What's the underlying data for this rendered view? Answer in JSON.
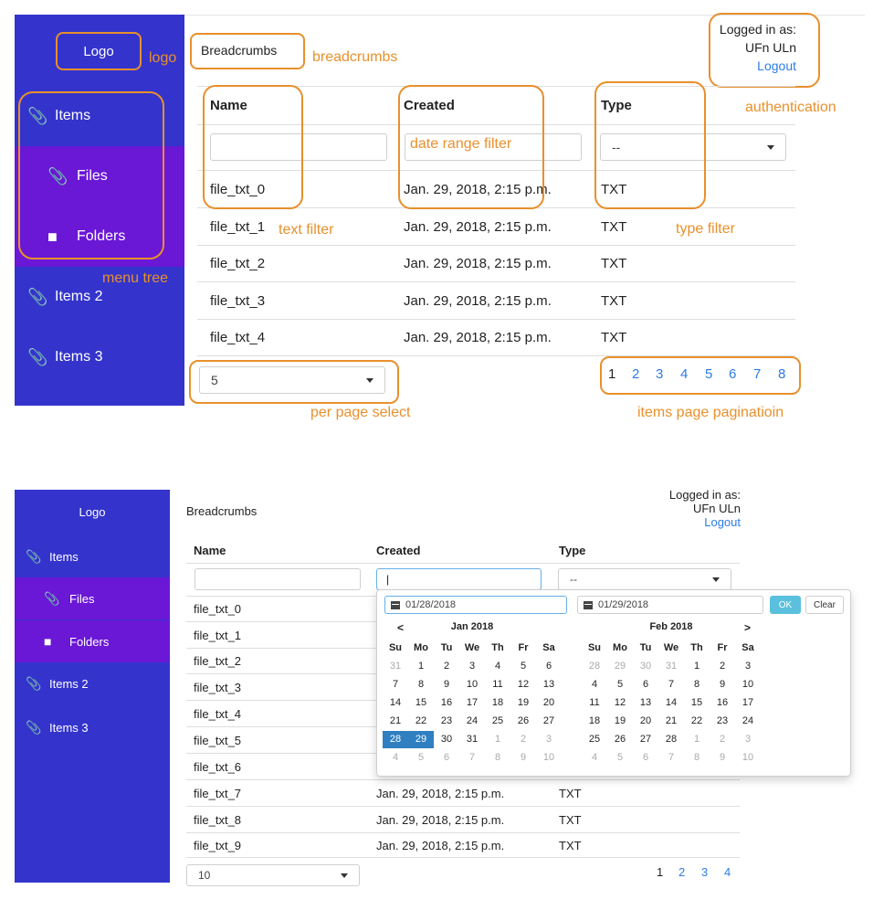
{
  "top": {
    "logo": "Logo",
    "breadcrumbs": "Breadcrumbs",
    "auth": {
      "logged_in_as": "Logged in as:",
      "user": "UFn ULn",
      "logout": "Logout"
    },
    "menu": [
      {
        "label": "Items",
        "icon": "paperclip-icon",
        "sub": false
      },
      {
        "label": "Files",
        "icon": "paperclip-icon",
        "sub": true
      },
      {
        "label": "Folders",
        "icon": "folder-icon",
        "sub": true
      },
      {
        "label": "Items 2",
        "icon": "paperclip-icon",
        "sub": false
      },
      {
        "label": "Items 3",
        "icon": "paperclip-icon",
        "sub": false
      }
    ],
    "columns": [
      "Name",
      "Created",
      "Type"
    ],
    "filters": {
      "type_select": "--"
    },
    "rows": [
      {
        "name": "file_txt_0",
        "created": "Jan. 29, 2018, 2:15 p.m.",
        "type": "TXT"
      },
      {
        "name": "file_txt_1",
        "created": "Jan. 29, 2018, 2:15 p.m.",
        "type": "TXT"
      },
      {
        "name": "file_txt_2",
        "created": "Jan. 29, 2018, 2:15 p.m.",
        "type": "TXT"
      },
      {
        "name": "file_txt_3",
        "created": "Jan. 29, 2018, 2:15 p.m.",
        "type": "TXT"
      },
      {
        "name": "file_txt_4",
        "created": "Jan. 29, 2018, 2:15 p.m.",
        "type": "TXT"
      }
    ],
    "per_page": "5",
    "pages": [
      "1",
      "2",
      "3",
      "4",
      "5",
      "6",
      "7",
      "8"
    ],
    "annotations": {
      "logo": "logo",
      "breadcrumbs": "breadcrumbs",
      "authentication": "authentication",
      "date_range_filter": "date range filter",
      "text_filter": "text filter",
      "type_filter": "type filter",
      "menu_tree": "menu tree",
      "per_page_select": "per page select",
      "pagination": "items page paginatioin"
    },
    "annotation_color": "#e8902c"
  },
  "bottom": {
    "logo": "Logo",
    "breadcrumbs": "Breadcrumbs",
    "auth": {
      "logged_in_as": "Logged in as:",
      "user": "UFn ULn",
      "logout": "Logout"
    },
    "menu": [
      {
        "label": "Items",
        "icon": "paperclip-icon",
        "sub": false
      },
      {
        "label": "Files",
        "icon": "paperclip-icon",
        "sub": true
      },
      {
        "label": "Folders",
        "icon": "folder-icon",
        "sub": true
      },
      {
        "label": "Items 2",
        "icon": "paperclip-icon",
        "sub": false
      },
      {
        "label": "Items 3",
        "icon": "paperclip-icon",
        "sub": false
      }
    ],
    "columns": [
      "Name",
      "Created",
      "Type"
    ],
    "filters": {
      "type_select": "--",
      "date_value": "|"
    },
    "rows": [
      {
        "name": "file_txt_0",
        "created": "",
        "type": ""
      },
      {
        "name": "file_txt_1",
        "created": "",
        "type": ""
      },
      {
        "name": "file_txt_2",
        "created": "",
        "type": ""
      },
      {
        "name": "file_txt_3",
        "created": "",
        "type": ""
      },
      {
        "name": "file_txt_4",
        "created": "",
        "type": ""
      },
      {
        "name": "file_txt_5",
        "created": "",
        "type": ""
      },
      {
        "name": "file_txt_6",
        "created": "",
        "type": ""
      },
      {
        "name": "file_txt_7",
        "created": "Jan. 29, 2018, 2:15 p.m.",
        "type": "TXT"
      },
      {
        "name": "file_txt_8",
        "created": "Jan. 29, 2018, 2:15 p.m.",
        "type": "TXT"
      },
      {
        "name": "file_txt_9",
        "created": "Jan. 29, 2018, 2:15 p.m.",
        "type": "TXT"
      }
    ],
    "per_page": "10",
    "pages": [
      "1",
      "2",
      "3",
      "4"
    ],
    "datepicker": {
      "start": "01/28/2018",
      "end": "01/29/2018",
      "ok": "OK",
      "clear": "Clear",
      "weekdays": [
        "Su",
        "Mo",
        "Tu",
        "We",
        "Th",
        "Fr",
        "Sa"
      ],
      "prev": "<",
      "next": ">",
      "months": [
        {
          "title": "Jan 2018",
          "weeks": [
            [
              [
                "31",
                "off"
              ],
              [
                "1",
                ""
              ],
              [
                "2",
                ""
              ],
              [
                "3",
                ""
              ],
              [
                "4",
                ""
              ],
              [
                "5",
                ""
              ],
              [
                "6",
                ""
              ]
            ],
            [
              [
                "7",
                ""
              ],
              [
                "8",
                ""
              ],
              [
                "9",
                ""
              ],
              [
                "10",
                ""
              ],
              [
                "11",
                ""
              ],
              [
                "12",
                ""
              ],
              [
                "13",
                ""
              ]
            ],
            [
              [
                "14",
                ""
              ],
              [
                "15",
                ""
              ],
              [
                "16",
                ""
              ],
              [
                "17",
                ""
              ],
              [
                "18",
                ""
              ],
              [
                "19",
                ""
              ],
              [
                "20",
                ""
              ]
            ],
            [
              [
                "21",
                ""
              ],
              [
                "22",
                ""
              ],
              [
                "23",
                ""
              ],
              [
                "24",
                ""
              ],
              [
                "25",
                ""
              ],
              [
                "26",
                ""
              ],
              [
                "27",
                ""
              ]
            ],
            [
              [
                "28",
                "sel"
              ],
              [
                "29",
                "sel"
              ],
              [
                "30",
                ""
              ],
              [
                "31",
                ""
              ],
              [
                "1",
                "off"
              ],
              [
                "2",
                "off"
              ],
              [
                "3",
                "off"
              ]
            ],
            [
              [
                "4",
                "off"
              ],
              [
                "5",
                "off"
              ],
              [
                "6",
                "off"
              ],
              [
                "7",
                "off"
              ],
              [
                "8",
                "off"
              ],
              [
                "9",
                "off"
              ],
              [
                "10",
                "off"
              ]
            ]
          ]
        },
        {
          "title": "Feb 2018",
          "weeks": [
            [
              [
                "28",
                "off"
              ],
              [
                "29",
                "off"
              ],
              [
                "30",
                "off"
              ],
              [
                "31",
                "off"
              ],
              [
                "1",
                ""
              ],
              [
                "2",
                ""
              ],
              [
                "3",
                ""
              ]
            ],
            [
              [
                "4",
                ""
              ],
              [
                "5",
                ""
              ],
              [
                "6",
                ""
              ],
              [
                "7",
                ""
              ],
              [
                "8",
                ""
              ],
              [
                "9",
                ""
              ],
              [
                "10",
                ""
              ]
            ],
            [
              [
                "11",
                ""
              ],
              [
                "12",
                ""
              ],
              [
                "13",
                ""
              ],
              [
                "14",
                ""
              ],
              [
                "15",
                ""
              ],
              [
                "16",
                ""
              ],
              [
                "17",
                ""
              ]
            ],
            [
              [
                "18",
                ""
              ],
              [
                "19",
                ""
              ],
              [
                "20",
                ""
              ],
              [
                "21",
                ""
              ],
              [
                "22",
                ""
              ],
              [
                "23",
                ""
              ],
              [
                "24",
                ""
              ]
            ],
            [
              [
                "25",
                ""
              ],
              [
                "26",
                ""
              ],
              [
                "27",
                ""
              ],
              [
                "28",
                ""
              ],
              [
                "1",
                "off"
              ],
              [
                "2",
                "off"
              ],
              [
                "3",
                "off"
              ]
            ],
            [
              [
                "4",
                "off"
              ],
              [
                "5",
                "off"
              ],
              [
                "6",
                "off"
              ],
              [
                "7",
                "off"
              ],
              [
                "8",
                "off"
              ],
              [
                "9",
                "off"
              ],
              [
                "10",
                "off"
              ]
            ]
          ]
        }
      ]
    }
  },
  "colors": {
    "sidebar": "#3434cd",
    "submenu": "#6a17d6",
    "link": "#2c7be5",
    "selected_day": "#2f7fc1",
    "ok_button": "#5bc0de"
  }
}
